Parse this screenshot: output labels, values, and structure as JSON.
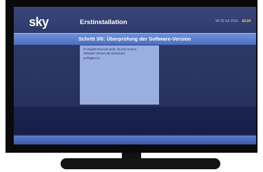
{
  "header": {
    "logo": "sky",
    "title": "Erstinstallation",
    "date": "Mi 20 Jul 2016",
    "time": "10:24"
  },
  "step": {
    "label": "Schritt 3/6: Überprüfung der Software-Version"
  },
  "info": {
    "text": "Ihr Digital-Receiver prüft, ob eine neuere Software-Version als Download verfügbar ist."
  },
  "colors": {
    "accent_yellow": "#ffe14a",
    "step_bar": "#5b7bcf",
    "screen_bg": "#2f3a6a",
    "info_box": "#9aaee0"
  }
}
